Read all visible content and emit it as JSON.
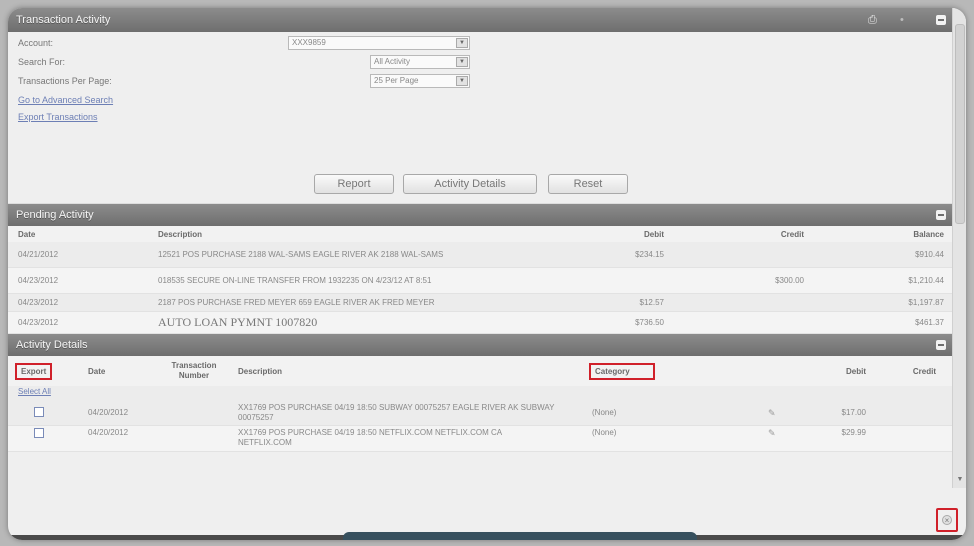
{
  "transaction_activity": {
    "title": "Transaction Activity",
    "labels": {
      "account": "Account:",
      "search_for": "Search For:",
      "per_page": "Transactions Per Page:"
    },
    "account_value": "XXX9859",
    "search_for_value": "All Activity",
    "per_page_value": "25 Per Page",
    "links": {
      "advanced_search": "Go to Advanced Search",
      "export": "Export Transactions"
    },
    "buttons": {
      "report": "Report",
      "activity_details": "Activity Details",
      "reset": "Reset"
    }
  },
  "pending_activity": {
    "title": "Pending Activity",
    "columns": [
      "Date",
      "Description",
      "Debit",
      "Credit",
      "Balance"
    ],
    "rows": [
      {
        "date": "04/21/2012",
        "description": "12521 POS PURCHASE 2188 WAL-SAMS EAGLE RIVER AK 2188 WAL-SAMS",
        "debit": "$234.15",
        "credit": "",
        "balance": "$910.44"
      },
      {
        "date": "04/23/2012",
        "description": "018535 SECURE ON-LINE TRANSFER FROM 1932235 ON 4/23/12 AT 8:51",
        "debit": "",
        "credit": "$300.00",
        "balance": "$1,210.44"
      },
      {
        "date": "04/23/2012",
        "description": "2187 POS PURCHASE FRED MEYER 659 EAGLE RIVER AK FRED MEYER",
        "debit": "$12.57",
        "credit": "",
        "balance": "$1,197.87"
      },
      {
        "date": "04/23/2012",
        "description": "AUTO LOAN PYMNT 1007820",
        "debit": "$736.50",
        "credit": "",
        "balance": "$461.37"
      }
    ]
  },
  "activity_details": {
    "title": "Activity Details",
    "columns": {
      "export": "Export",
      "date": "Date",
      "transaction_number": "Transaction Number",
      "description": "Description",
      "category": "Category",
      "debit": "Debit",
      "credit": "Credit"
    },
    "select_all": "Select All",
    "rows": [
      {
        "date": "04/20/2012",
        "description": "XX1769 POS PURCHASE 04/19 18:50 SUBWAY 00075257 EAGLE RIVER AK SUBWAY 00075257",
        "category": "(None)",
        "debit": "$17.00",
        "credit": ""
      },
      {
        "date": "04/20/2012",
        "description": "XX1769 POS PURCHASE 04/19 18:50 NETFLIX.COM NETFLIX.COM CA NETFLIX.COM",
        "category": "(None)",
        "debit": "$29.99",
        "credit": ""
      }
    ]
  },
  "icons": {
    "print": "printer-icon",
    "help": "help-icon",
    "collapse": "collapse-icon",
    "close": "close-icon"
  },
  "colors": {
    "header": "#7a7a7a",
    "highlight": "#d0202a",
    "link": "#6d7fb5",
    "bottom_bar": "#37505e"
  }
}
